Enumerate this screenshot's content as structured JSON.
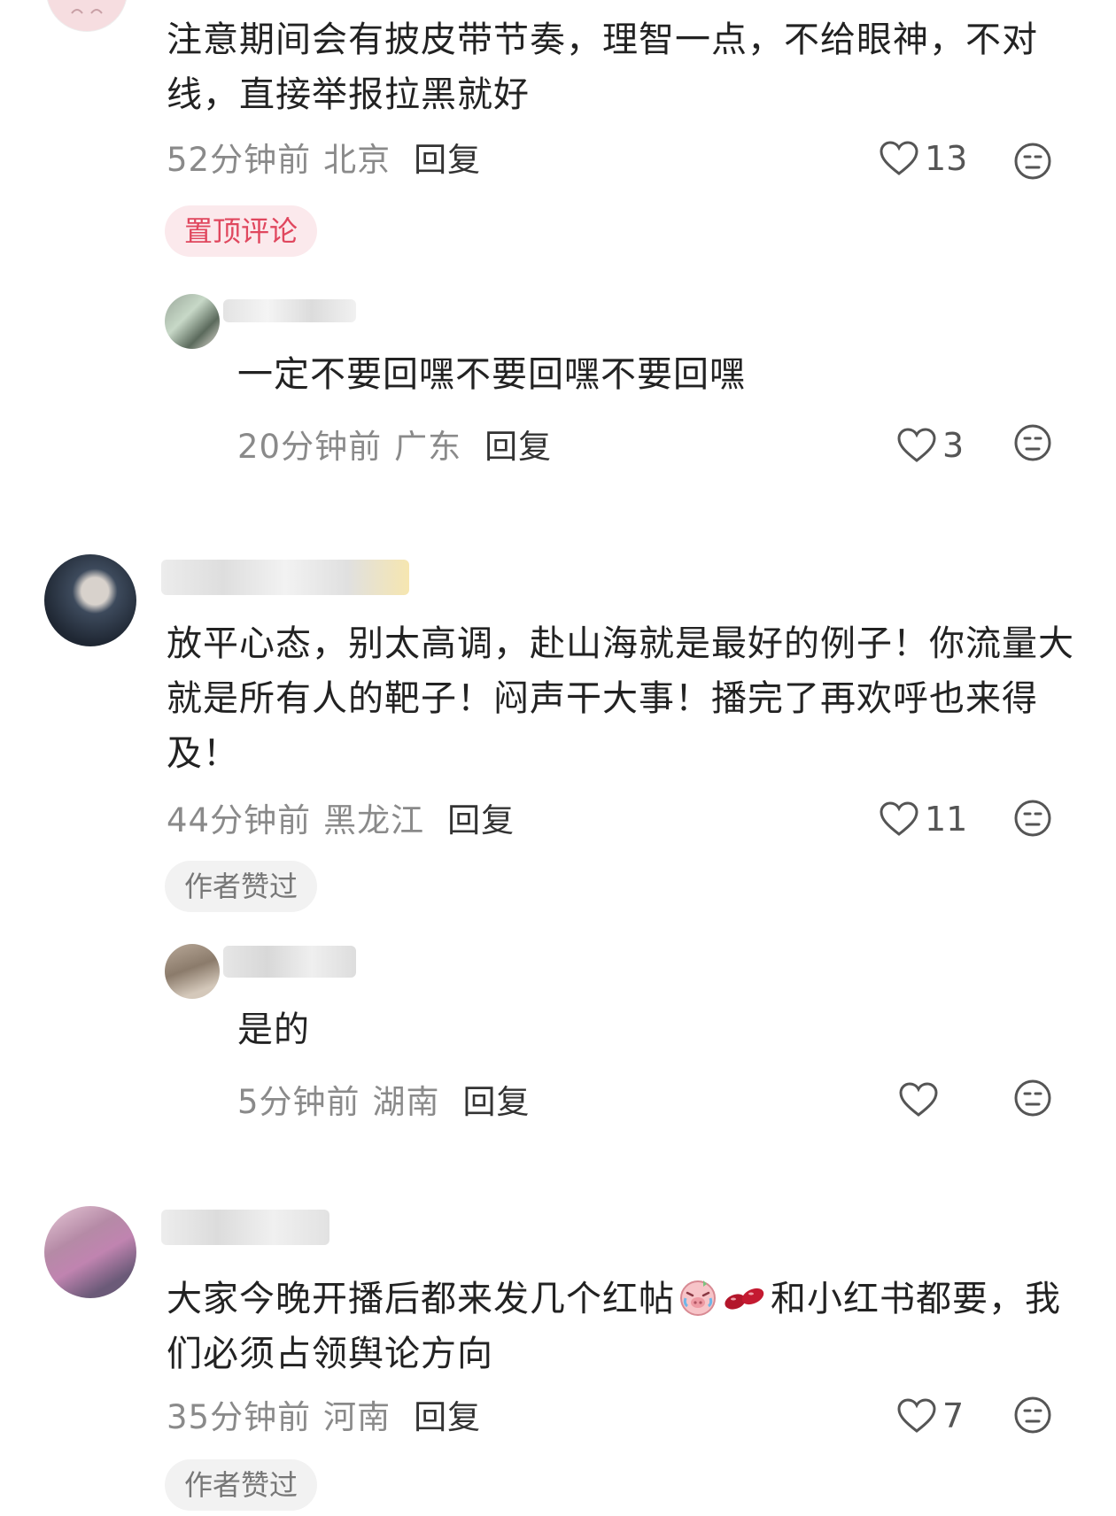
{
  "comments": [
    {
      "text": "注意期间会有披皮带节奏，理智一点，不给眼神，不对线，直接举报拉黑就好",
      "time": "52分钟前",
      "location": "北京",
      "reply_label": "回复",
      "likes": "13",
      "badge": "置顶评论",
      "replies": [
        {
          "text": "一定不要回嘿不要回嘿不要回嘿",
          "time": "20分钟前",
          "location": "广东",
          "reply_label": "回复",
          "likes": "3"
        }
      ]
    },
    {
      "text": "放平心态，别太高调，赴山海就是最好的例子！你流量大就是所有人的靶子！闷声干大事！播完了再欢呼也来得及！",
      "time": "44分钟前",
      "location": "黑龙江",
      "reply_label": "回复",
      "likes": "11",
      "badge": "作者赞过",
      "replies": [
        {
          "text": "是的",
          "time": "5分钟前",
          "location": "湖南",
          "reply_label": "回复",
          "likes": ""
        }
      ]
    },
    {
      "text_before_emoji": "大家今晚开播后都来发几个红帖",
      "text_after_emoji": "和小红书都要，我们必须占领舆论方向",
      "time": "35分钟前",
      "location": "河南",
      "reply_label": "回复",
      "likes": "7",
      "badge": "作者赞过"
    }
  ],
  "icons": {
    "like": "heart-outline-icon",
    "dislike": "neutral-face-icon",
    "emoji_1": "crying-pig-emoji",
    "emoji_2": "red-beans-emoji"
  },
  "colors": {
    "pin_badge_bg": "#fbe9ec",
    "pin_badge_text": "#e0475e",
    "author_badge_bg": "#f2f2f2",
    "meta_text": "#8a8a8a"
  }
}
